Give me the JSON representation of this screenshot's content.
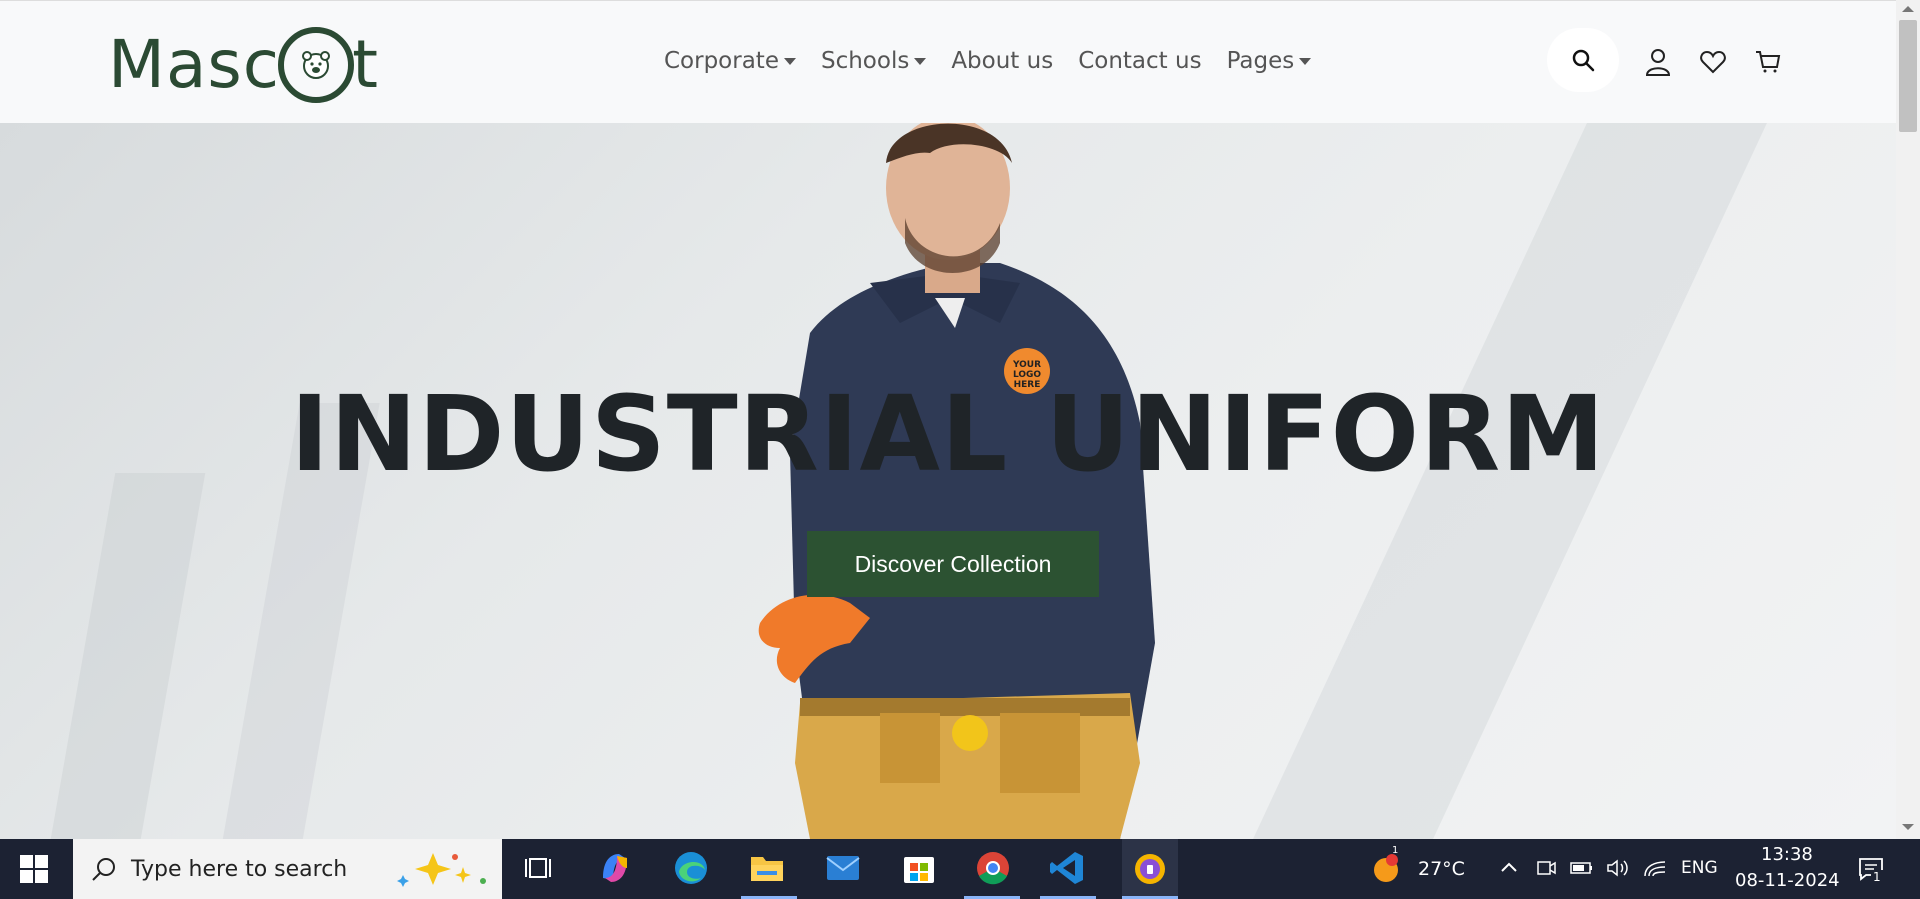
{
  "brand": {
    "logo_text_left": "Masc",
    "logo_text_right": "t"
  },
  "nav": {
    "items": [
      {
        "label": "Corporate",
        "dropdown": true
      },
      {
        "label": "Schools",
        "dropdown": true
      },
      {
        "label": "About us",
        "dropdown": false
      },
      {
        "label": "Contact us",
        "dropdown": false
      },
      {
        "label": "Pages",
        "dropdown": true
      }
    ]
  },
  "header_icons": [
    "search-icon",
    "user-icon",
    "heart-icon",
    "cart-icon"
  ],
  "hero": {
    "title": "INDUSTRIAL UNIFORM",
    "cta_label": "Discover Collection",
    "patch_text": "YOUR LOGO HERE"
  },
  "taskbar": {
    "search_placeholder": "Type here to search",
    "weather_temp": "27°C",
    "weather_badge": "1",
    "language": "ENG",
    "time": "13:38",
    "date": "08-11-2024",
    "notification_count": "1"
  },
  "colors": {
    "brand_green": "#2c5232",
    "title_dark": "#1f2428",
    "nav_text": "#555555",
    "taskbar": "#1c2233"
  }
}
